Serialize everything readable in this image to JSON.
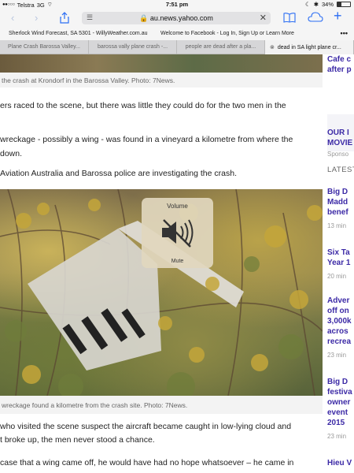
{
  "status_bar": {
    "signal_dots": "●●○○○",
    "carrier": "Telstra",
    "network": "3G",
    "time": "7:51 pm",
    "battery_pct": "34%"
  },
  "toolbar": {
    "url": "au.news.yahoo.com"
  },
  "bookmarks": [
    "Sherlock Wind Forecast, SA 5301 - WillyWeather.com.au",
    "Welcome to Facebook - Log In, Sign Up or Learn More"
  ],
  "bookmarks_more": "•••",
  "tabs": [
    {
      "label": "Plane Crash Barossa Valley..."
    },
    {
      "label": "barossa vally plane crash -..."
    },
    {
      "label": "people are dead after a pla..."
    },
    {
      "label": "dead in SA light plane cr..."
    }
  ],
  "article": {
    "caption_top": "the crash at Krondorf in the Barossa Valley. Photo: 7News.",
    "para1_line1": "ers raced to the scene, but there was little they could do for the two men in the",
    "para2_line1": "wreckage - possibly a wing - was found in a vineyard a kilometre from where the",
    "para2_line2": "down.",
    "para3": "Aviation Australia and Barossa police are investigating the crash.",
    "caption_photo": "wreckage found a kilometre from the crash site. Photo: 7News.",
    "para4_line1": "who visited the scene suspect the aircraft became caught in low-lying cloud and",
    "para4_line2": "t broke up, the men never stood a chance.",
    "para5_line1": "case that a wing came off, he would have had no hope whatsoever – he came in"
  },
  "volume_hud": {
    "title": "Volume",
    "status": "Mute"
  },
  "sidebar": {
    "card1": {
      "line1": "Cafe c",
      "line2": "after p"
    },
    "promo": {
      "line1": "OUR I",
      "line2": "MOVIE",
      "sponsor": "Sponso"
    },
    "latest_heading": "LATEST",
    "items": [
      {
        "lines": [
          "Big D",
          "Madd",
          "benef"
        ],
        "time": "13 min"
      },
      {
        "lines": [
          "Six Ta",
          "Year 1"
        ],
        "time": "20 min"
      },
      {
        "lines": [
          "Adver",
          "off on",
          "3,000k",
          "acros",
          "recrea"
        ],
        "time": "23 min"
      },
      {
        "lines": [
          "Big D",
          "festiva",
          "owner",
          "event",
          "2015"
        ],
        "time": "23 min"
      },
      {
        "lines": [
          "Hieu V"
        ],
        "time": ""
      }
    ]
  }
}
